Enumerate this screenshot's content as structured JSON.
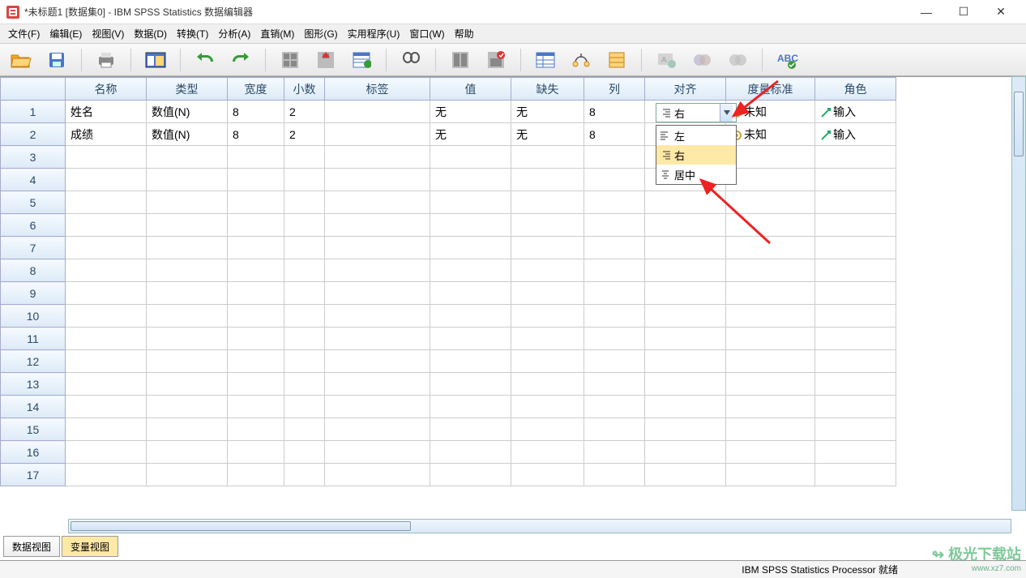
{
  "window": {
    "title": "*未标题1 [数据集0] - IBM SPSS Statistics 数据编辑器"
  },
  "menu": {
    "file": "文件(F)",
    "edit": "编辑(E)",
    "view": "视图(V)",
    "data": "数据(D)",
    "transform": "转换(T)",
    "analyze": "分析(A)",
    "direct": "直销(M)",
    "graph": "图形(G)",
    "util": "实用程序(U)",
    "window": "窗口(W)",
    "help": "帮助"
  },
  "columns": {
    "name": "名称",
    "type": "类型",
    "width": "宽度",
    "decimals": "小数",
    "label": "标签",
    "values": "值",
    "missing": "缺失",
    "cols": "列",
    "align": "对齐",
    "measure": "度量标准",
    "role": "角色"
  },
  "rows": [
    {
      "n": "1",
      "name": "姓名",
      "type": "数值(N)",
      "width": "8",
      "dec": "2",
      "label": "",
      "val": "无",
      "miss": "无",
      "col": "8",
      "align": "右",
      "meas": "未知",
      "role": "输入"
    },
    {
      "n": "2",
      "name": "成绩",
      "type": "数值(N)",
      "width": "8",
      "dec": "2",
      "label": "",
      "val": "无",
      "miss": "无",
      "col": "8",
      "align": "",
      "meas": "未知",
      "role": "输入"
    }
  ],
  "emptyRows": [
    "3",
    "4",
    "5",
    "6",
    "7",
    "8",
    "9",
    "10",
    "11",
    "12",
    "13",
    "14",
    "15",
    "16",
    "17"
  ],
  "dropdown": {
    "selected": "右",
    "options": [
      {
        "label": "左"
      },
      {
        "label": "右",
        "selected": true
      },
      {
        "label": "居中"
      }
    ]
  },
  "tabs": {
    "data": "数据视图",
    "variable": "变量视图"
  },
  "status": {
    "processor": "IBM SPSS Statistics Processor 就绪"
  },
  "watermark": {
    "name": "极光下载站",
    "url": "www.xz7.com"
  }
}
